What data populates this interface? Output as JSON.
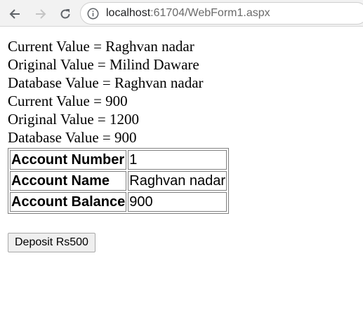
{
  "browser": {
    "url_host": "localhost",
    "url_rest": ":61704/WebForm1.aspx"
  },
  "page": {
    "lines": [
      "Current Value = Raghvan nadar",
      "Original Value = Milind Daware",
      "Database Value = Raghvan nadar",
      "Current Value = 900",
      "Original Value = 1200",
      "Database Value = 900"
    ],
    "table": [
      {
        "label": "Account Number",
        "value": "1"
      },
      {
        "label": "Account Name",
        "value": "Raghvan nadar"
      },
      {
        "label": "Account Balance",
        "value": "900"
      }
    ],
    "deposit_label": "Deposit Rs500"
  }
}
